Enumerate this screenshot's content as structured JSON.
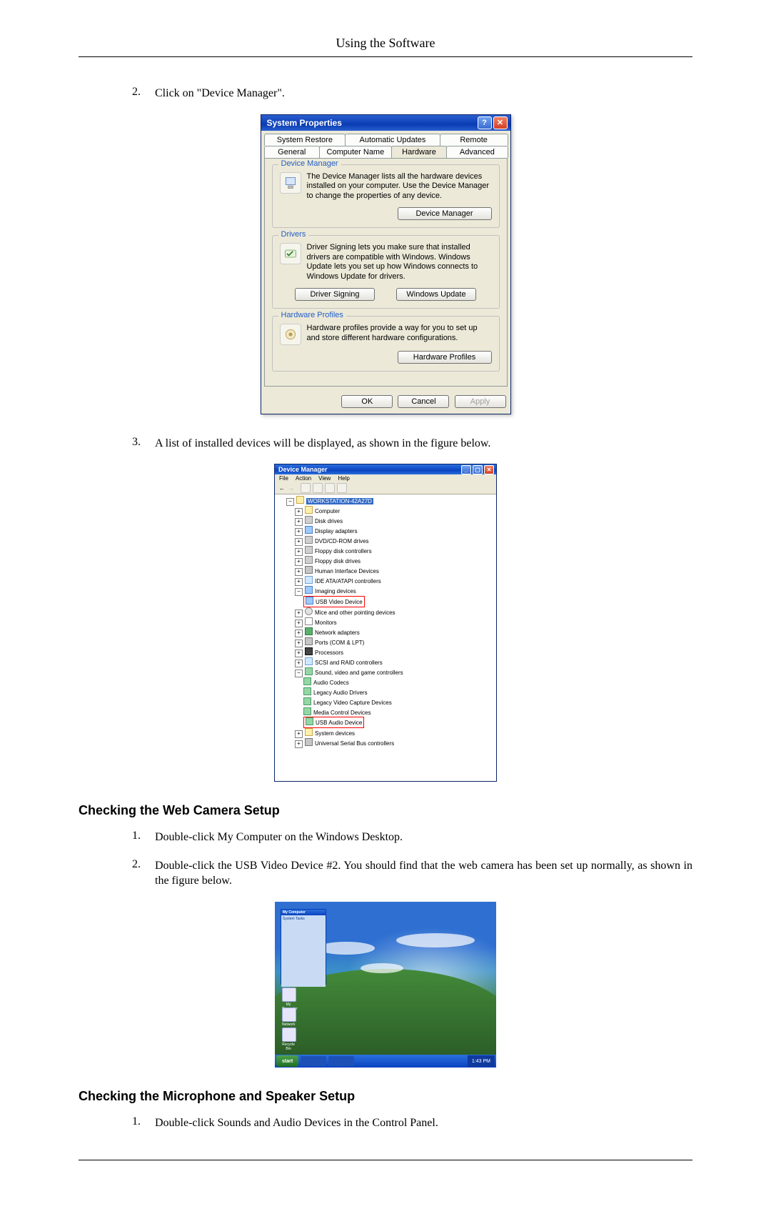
{
  "page_header": "Using the Software",
  "section1": {
    "step2": {
      "num": "2.",
      "text": "Click on \"Device Manager\"."
    },
    "step3": {
      "num": "3.",
      "text": "A list of installed devices will be displayed, as shown in the figure below."
    }
  },
  "sysprops": {
    "title": "System Properties",
    "tabs_row1": [
      "System Restore",
      "Automatic Updates",
      "Remote"
    ],
    "tabs_row2": [
      "General",
      "Computer Name",
      "Hardware",
      "Advanced"
    ],
    "active_tab": "Hardware",
    "groups": {
      "devmgr": {
        "legend": "Device Manager",
        "text": "The Device Manager lists all the hardware devices installed on your computer. Use the Device Manager to change the properties of any device.",
        "button": "Device Manager"
      },
      "drivers": {
        "legend": "Drivers",
        "text": "Driver Signing lets you make sure that installed drivers are compatible with Windows. Windows Update lets you set up how Windows connects to Windows Update for drivers.",
        "btn1": "Driver Signing",
        "btn2": "Windows Update"
      },
      "hwprofiles": {
        "legend": "Hardware Profiles",
        "text": "Hardware profiles provide a way for you to set up and store different hardware configurations.",
        "button": "Hardware Profiles"
      }
    },
    "footer": {
      "ok": "OK",
      "cancel": "Cancel",
      "apply": "Apply"
    }
  },
  "devmgr_win": {
    "title": "Device Manager",
    "menus": [
      "File",
      "Action",
      "View",
      "Help"
    ],
    "root": "WORKSTATION-42A27D",
    "items": [
      "Computer",
      "Disk drives",
      "Display adapters",
      "DVD/CD-ROM drives",
      "Floppy disk controllers",
      "Floppy disk drives",
      "Human Interface Devices",
      "IDE ATA/ATAPI controllers",
      "Imaging devices"
    ],
    "highlight1": "USB Video Device",
    "items2": [
      "Mice and other pointing devices",
      "Monitors",
      "Network adapters",
      "Ports (COM & LPT)",
      "Processors",
      "SCSI and RAID controllers",
      "Sound, video and game controllers"
    ],
    "svg_children": [
      "Audio Codecs",
      "Legacy Audio Drivers",
      "Legacy Video Capture Devices",
      "Media Control Devices"
    ],
    "highlight2": "USB Audio Device",
    "items3": [
      "System devices",
      "Universal Serial Bus controllers"
    ]
  },
  "webcam_section": {
    "heading": "Checking the Web Camera Setup",
    "step1": {
      "num": "1.",
      "text": "Double-click My Computer on the Windows Desktop."
    },
    "step2": {
      "num": "2.",
      "text": "Double-click the USB Video Device #2. You should find that the web camera has been set up normally, as shown in the figure below."
    }
  },
  "desktop": {
    "mycomputer_title": "My Computer",
    "side_label": "System Tasks",
    "start": "start",
    "tray_time": "1:43 PM",
    "icons": [
      "My Computer",
      "Network",
      "Recycle Bin"
    ]
  },
  "mic_section": {
    "heading": "Checking the Microphone and Speaker Setup",
    "step1": {
      "num": "1.",
      "text": "Double-click Sounds and Audio Devices in the Control Panel."
    }
  }
}
